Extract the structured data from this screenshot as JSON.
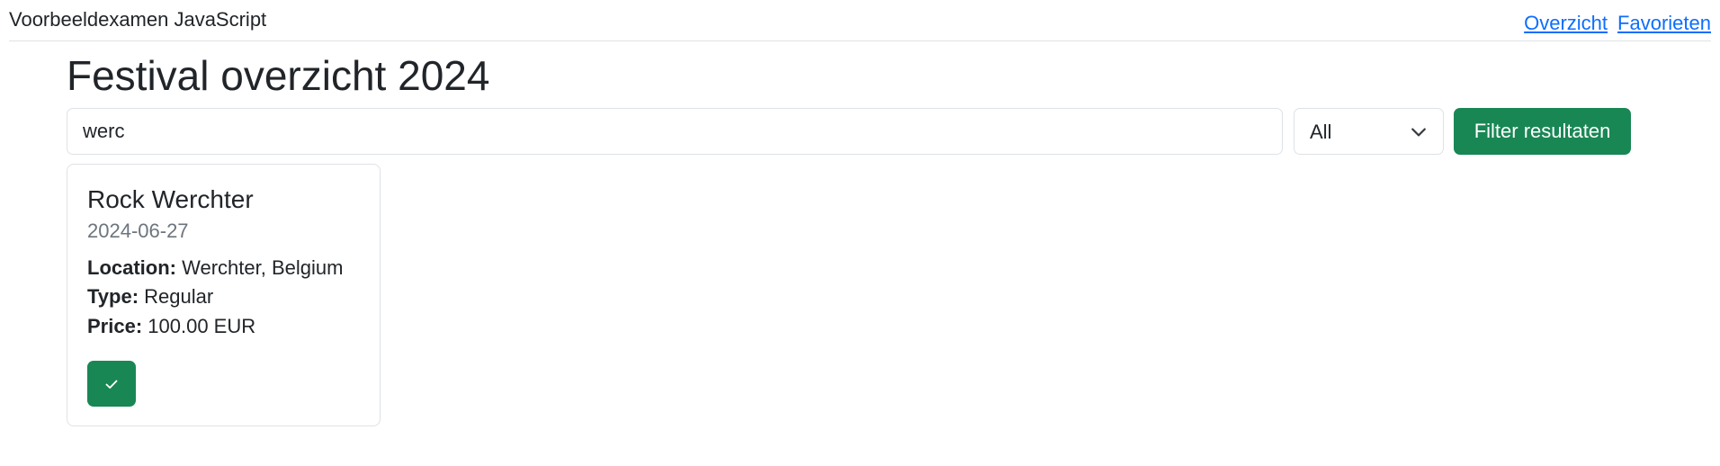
{
  "header": {
    "app_title": "Voorbeeldexamen JavaScript",
    "nav": [
      {
        "label": "Overzicht"
      },
      {
        "label": "Favorieten"
      }
    ]
  },
  "main": {
    "title": "Festival overzicht 2024",
    "filter": {
      "search_value": "werc",
      "type_select": {
        "selected": "All"
      },
      "filter_button_label": "Filter resultaten"
    },
    "festivals": [
      {
        "name": "Rock Werchter",
        "date": "2024-06-27",
        "location_label": "Location:",
        "location": "Werchter, Belgium",
        "type_label": "Type:",
        "type": "Regular",
        "price_label": "Price:",
        "price": "100.00 EUR",
        "action_icon": "check-icon"
      }
    ]
  },
  "colors": {
    "accent_green": "#198754",
    "link_blue": "#0d6efd",
    "border": "#dee2e6",
    "muted_text": "#6c757d"
  }
}
